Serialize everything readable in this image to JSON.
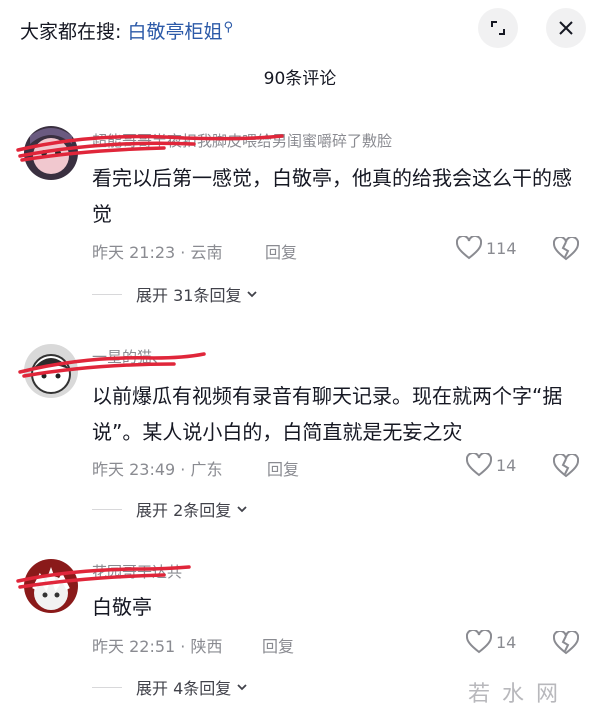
{
  "header": {
    "search_prefix": "大家都在搜:",
    "search_keyword": "白敬亭柜姐",
    "search_icon": "search-icon",
    "minimize_icon": "collapse-icon",
    "close_icon": "close-icon"
  },
  "comment_count": "90条评论",
  "comments": [
    {
      "username": "超能哥哥半夜扣我脚皮喂给男闺蜜嚼碎了敷脸",
      "text": "看完以后第一感觉，白敬亭，他真的给我会这么干的感觉",
      "time_loc": "昨天 21:23 · 云南",
      "reply": "回复",
      "likes": "114",
      "expand": "展开 31条回复"
    },
    {
      "username": "一星的猫、",
      "text": "以前爆瓜有视频有录音有聊天记录。现在就两个字“据说”。某人说小白的，白简直就是无妄之灾",
      "time_loc": "昨天 23:49 · 广东",
      "reply": "回复",
      "likes": "14",
      "expand": "展开 2条回复"
    },
    {
      "username": "花园哥干达共",
      "text": "白敬亭",
      "time_loc": "昨天 22:51 · 陕西",
      "reply": "回复",
      "likes": "14",
      "expand": "展开 4条回复"
    }
  ],
  "watermark": "若水网",
  "colors": {
    "accent": "#2c5aa8",
    "scribble": "#e0263a",
    "muted": "#8a8b91"
  }
}
